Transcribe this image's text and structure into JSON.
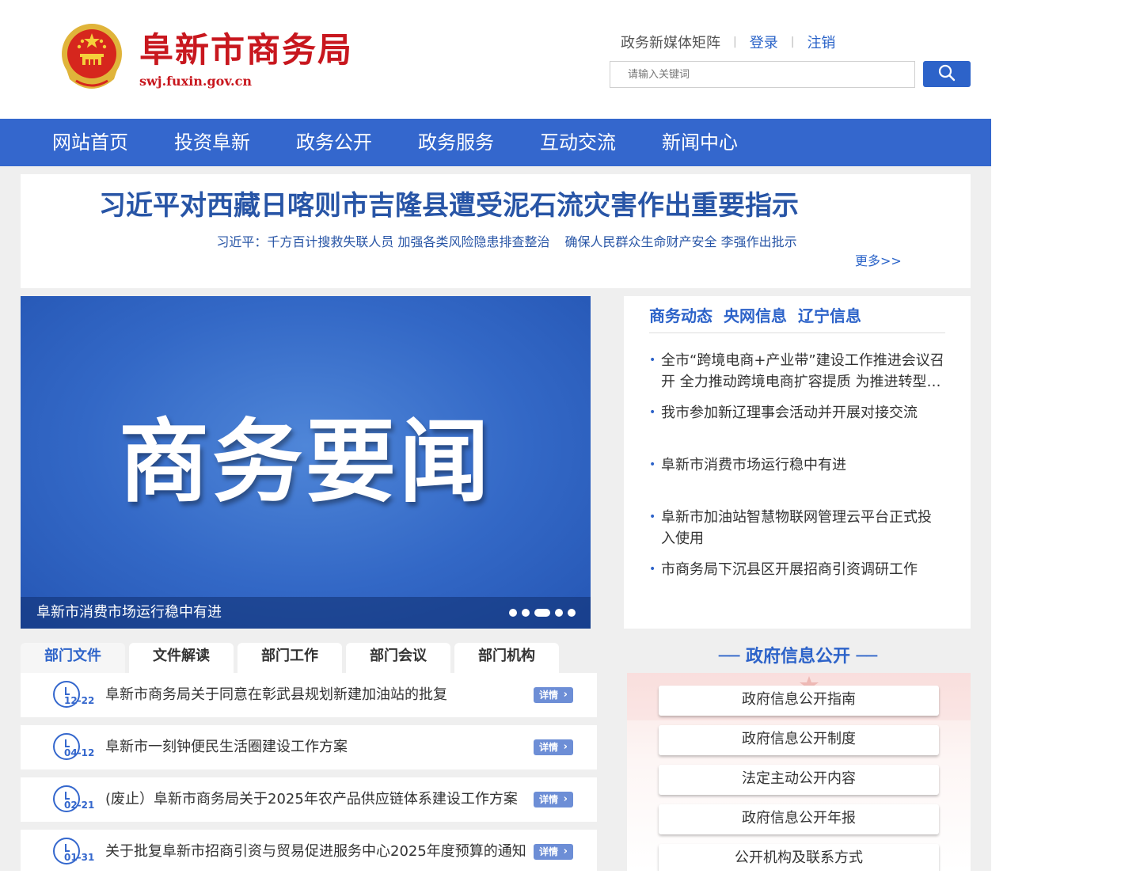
{
  "header": {
    "site_title": "阜新市商务局",
    "site_domain": "swj.fuxin.gov.cn",
    "top_links": {
      "media": "政务新媒体矩阵",
      "login": "登录",
      "logout": "注销"
    },
    "search": {
      "placeholder": "请输入关键词"
    }
  },
  "nav": {
    "items": [
      {
        "label": "网站首页"
      },
      {
        "label": "投资阜新"
      },
      {
        "label": "政务公开"
      },
      {
        "label": "政务服务"
      },
      {
        "label": "互动交流"
      },
      {
        "label": "新闻中心"
      }
    ]
  },
  "headline": {
    "title": "习近平对西藏日喀则市吉隆县遭受泥石流灾害作出重要指示",
    "sublinks": [
      "习近平：千方百计搜救失联人员 加强各类风险隐患排查整治",
      "确保人民群众生命财产安全 李强作出批示"
    ],
    "more": "更多>>"
  },
  "slider": {
    "title": "商务要闻",
    "caption": "阜新市消费市场运行稳中有进",
    "slide_count": 5,
    "active_slide": 3
  },
  "news": {
    "tabs": [
      "商务动态",
      "央网信息",
      "辽宁信息"
    ],
    "items": [
      "全市“跨境电商+产业带”建设工作推进会议召开 全力推动跨境电商扩容提质 为推进转型发展注入新动能",
      "我市参加新辽理事会活动并开展对接交流",
      "阜新市消费市场运行稳中有进",
      "阜新市加油站智慧物联网管理云平台正式投入使用",
      "市商务局下沉县区开展招商引资调研工作"
    ]
  },
  "docs": {
    "tabs": [
      "部门文件",
      "文件解读",
      "部门工作",
      "部门会议",
      "部门机构"
    ],
    "detail_label": "详情",
    "rows": [
      {
        "date": "12-22",
        "title": "阜新市商务局关于同意在彰武县规划新建加油站的批复"
      },
      {
        "date": "04-12",
        "title": "阜新市一刻钟便民生活圈建设工作方案"
      },
      {
        "date": "02-21",
        "title": "(废止）阜新市商务局关于2025年农产品供应链体系建设工作方案"
      },
      {
        "date": "01-31",
        "title": "关于批复阜新市招商引资与贸易促进服务中心2025年度预算的通知"
      }
    ]
  },
  "gov_info": {
    "title": "── 政府信息公开 ──",
    "buttons": [
      "政府信息公开指南",
      "政府信息公开制度",
      "法定主动公开内容",
      "政府信息公开年报",
      "公开机构及联系方式"
    ]
  },
  "colors": {
    "nav_blue": "#3467cd",
    "title_red": "#c8171e",
    "link_blue": "#2a63c8"
  }
}
